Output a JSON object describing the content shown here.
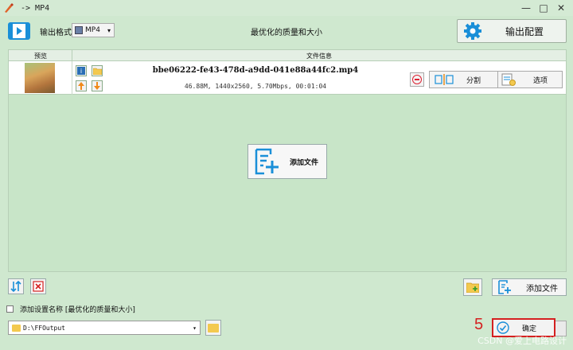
{
  "window": {
    "title": "-> MP4",
    "minimize": "—",
    "maximize": "□",
    "close": "✕"
  },
  "toolbar": {
    "format_label": "输出格式",
    "format_value": "MP4",
    "quality_text": "最优化的质量和大小",
    "output_config_label": "输出配置"
  },
  "file_list": {
    "columns": [
      "预览",
      "文件信息"
    ],
    "files": [
      {
        "name": "bbe06222-fe43-478d-a9dd-041e88a44fc2.mp4",
        "meta": "46.88M, 1440x2560, 5.70Mbps, 00:01:04",
        "split_label": "分割",
        "options_label": "选项"
      }
    ],
    "add_file_center_label": "添加文件"
  },
  "bottom": {
    "add_file_label": "添加文件",
    "preset_checkbox_label": "添加设置名称 [最优化的质量和大小]",
    "output_path": "D:\\FFOutput",
    "step_number": "5",
    "ok_label": "确定"
  },
  "watermark": "CSDN @爱上电路设计",
  "colors": {
    "background": "#cfe8cf",
    "accent": "#1a8fd8",
    "highlight_red": "#d42020"
  }
}
